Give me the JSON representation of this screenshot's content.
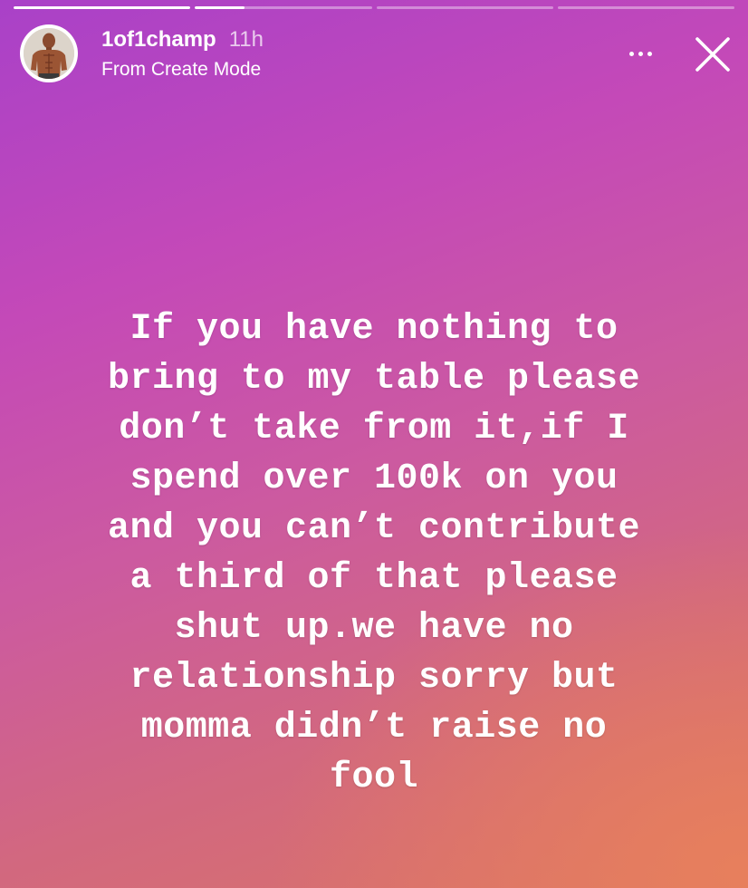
{
  "story": {
    "segments_total": 4,
    "current_segment": 2,
    "current_segment_progress": 0.28
  },
  "header": {
    "username": "1of1champ",
    "time_ago": "11h",
    "subtitle": "From Create Mode"
  },
  "icons": {
    "more": "more-horizontal-icon",
    "close": "close-icon"
  },
  "text": {
    "body": "If you have nothing to\nbring to my table please\ndon’t take from it,if I\nspend over 100k on you\nand you can’t contribute\na third of that please\nshut up.we have no\nrelationship sorry but\nmomma didn’t raise no\nfool"
  },
  "colors": {
    "gradient_start": "#a941c8",
    "gradient_end": "#da7466",
    "text": "#ffffff"
  }
}
